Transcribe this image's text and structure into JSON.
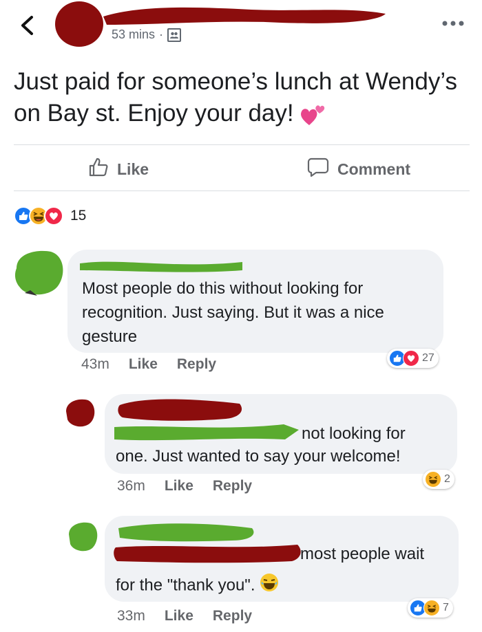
{
  "post": {
    "timestamp": "53 mins",
    "separator": "·",
    "text": "Just paid for someone’s lunch at Wendy’s on Bay st. Enjoy your day!",
    "actions": {
      "like": "Like",
      "comment": "Comment"
    },
    "reaction_count": "15"
  },
  "comments": [
    {
      "text": "Most people do this without looking for recognition. Just saying. But it was a nice gesture",
      "time": "43m",
      "like": "Like",
      "reply": "Reply",
      "reaction_count": "27"
    },
    {
      "text_line1": "not looking for",
      "text_line2": "one. Just wanted to say your welcome!",
      "time": "36m",
      "like": "Like",
      "reply": "Reply",
      "reaction_count": "2"
    },
    {
      "text_line1": "most people wait",
      "text_line2": "for the \"thank you\".",
      "time": "33m",
      "like": "Like",
      "reply": "Reply",
      "reaction_count": "7"
    }
  ],
  "colors": {
    "facebook_blue": "#1877f2",
    "redaction_red": "#8b0d0d",
    "redaction_green": "#5aab2f",
    "bubble_gray": "#f0f2f5"
  },
  "icons": [
    "back-arrow-icon",
    "more-options-icon",
    "privacy-friends-icon",
    "thumbs-up-icon",
    "comment-icon",
    "like-reaction-icon",
    "haha-reaction-icon",
    "love-reaction-icon",
    "two-hearts-emoji",
    "laughing-emoji"
  ]
}
